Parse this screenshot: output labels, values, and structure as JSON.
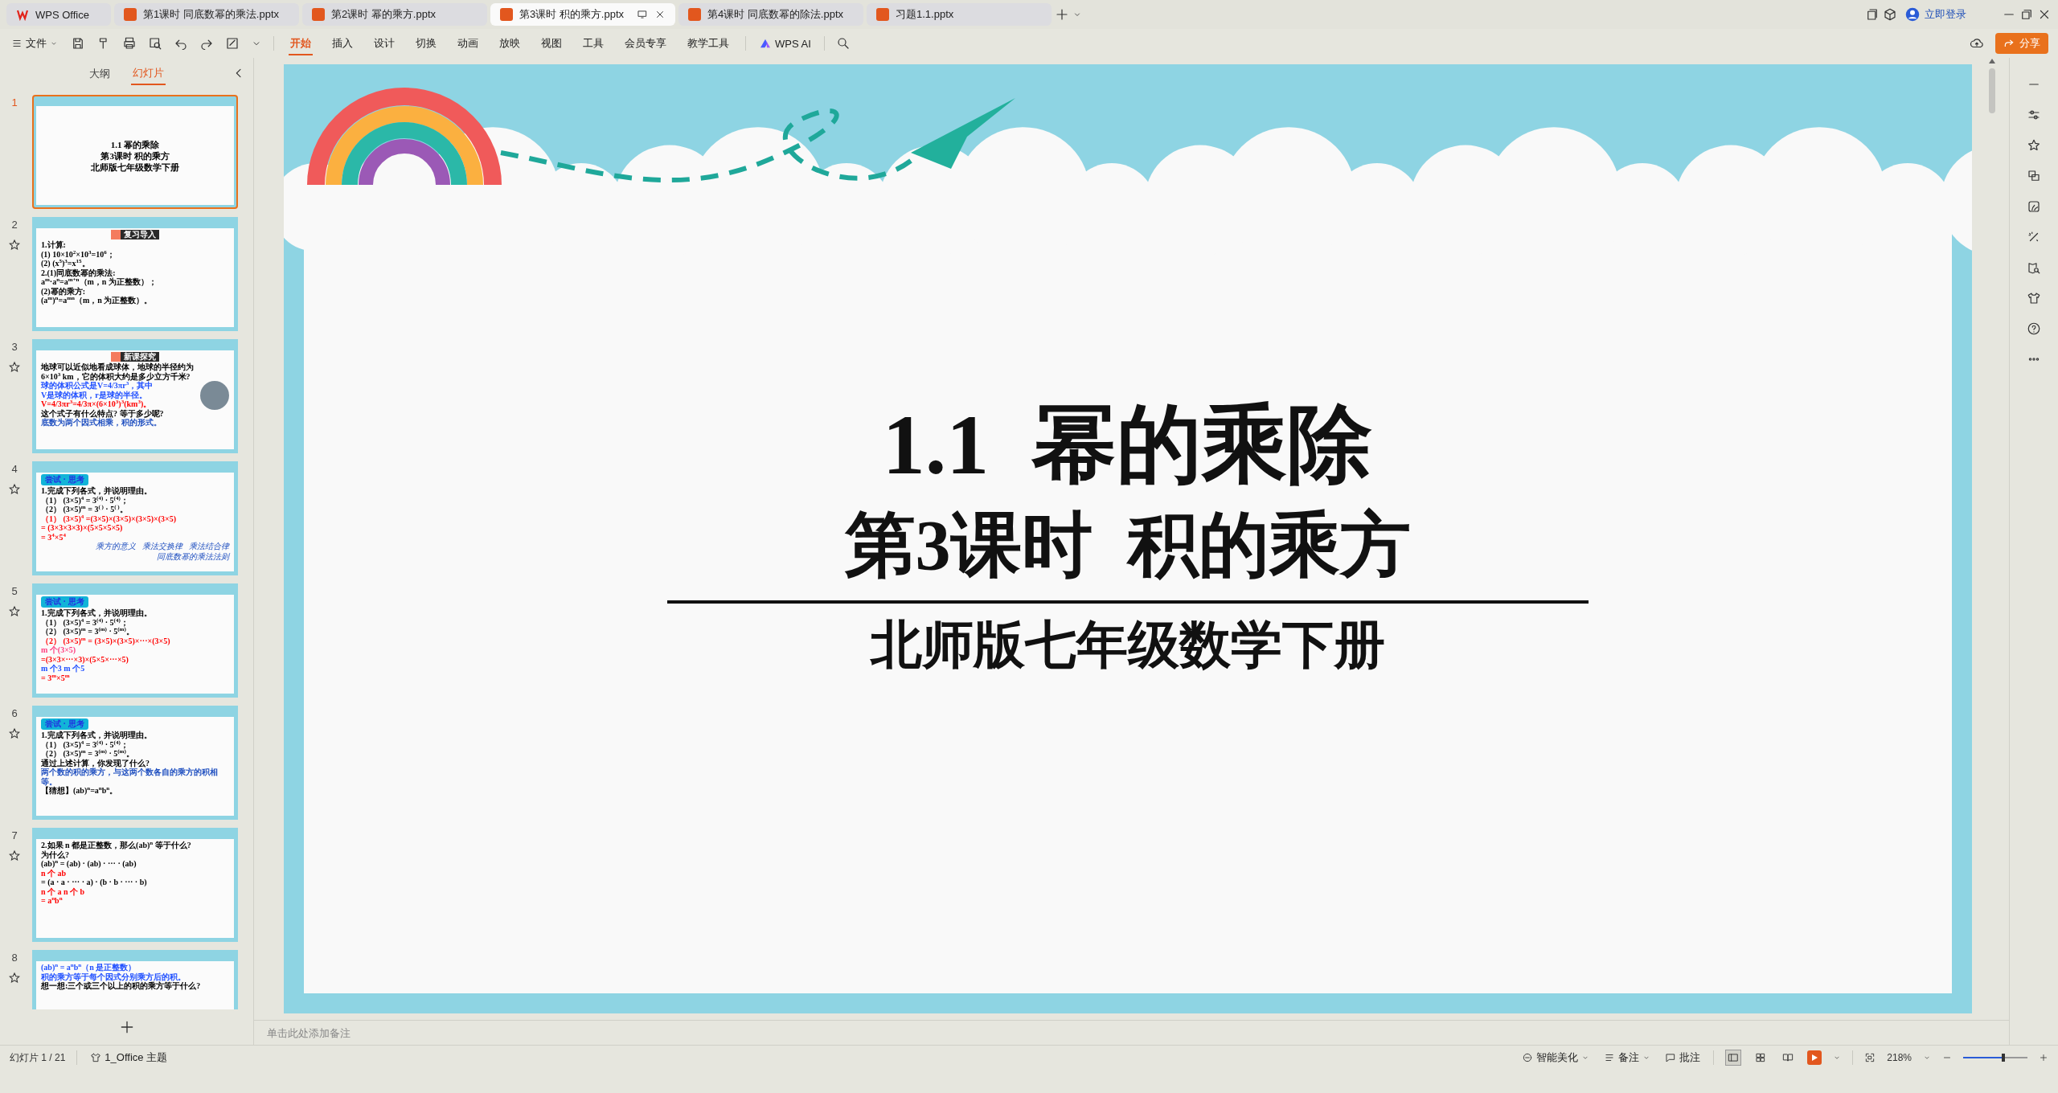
{
  "tabs": [
    {
      "label": "WPS Office",
      "kind": "home",
      "selected": false
    },
    {
      "label": "第1课时 同底数幂的乘法.pptx",
      "kind": "file",
      "selected": false
    },
    {
      "label": "第2课时 幂的乘方.pptx",
      "kind": "file",
      "selected": false
    },
    {
      "label": "第3课时 积的乘方.pptx",
      "kind": "file",
      "selected": true
    },
    {
      "label": "第4课时 同底数幂的除法.pptx",
      "kind": "file",
      "selected": false
    },
    {
      "label": "习题1.1.pptx",
      "kind": "file",
      "selected": false
    }
  ],
  "account": {
    "label": "立即登录"
  },
  "toolbar": {
    "file_menu": "文件",
    "ribbon_tabs": [
      {
        "label": "开始",
        "selected": true
      },
      {
        "label": "插入",
        "selected": false
      },
      {
        "label": "设计",
        "selected": false
      },
      {
        "label": "切换",
        "selected": false
      },
      {
        "label": "动画",
        "selected": false
      },
      {
        "label": "放映",
        "selected": false
      },
      {
        "label": "视图",
        "selected": false
      },
      {
        "label": "工具",
        "selected": false
      },
      {
        "label": "会员专享",
        "selected": false
      },
      {
        "label": "教学工具",
        "selected": false
      }
    ],
    "ai_label": "WPS AI",
    "share_label": "分享"
  },
  "side_panel": {
    "tabs": [
      {
        "label": "大纲",
        "selected": false
      },
      {
        "label": "幻灯片",
        "selected": true
      }
    ],
    "slides": [
      {
        "number": "1",
        "kind": "title",
        "selected": true,
        "animated": false,
        "lines": [
          {
            "text": "1.1  幂的乘除",
            "color": "#000000"
          },
          {
            "text": "第3课时  积的乘方",
            "color": "#000000"
          },
          {
            "text": "北师版七年级数学下册",
            "color": "#000000"
          }
        ]
      },
      {
        "number": "2",
        "kind": "content",
        "selected": false,
        "animated": true,
        "badge": {
          "text": "复习导入",
          "kind": "section"
        },
        "lines": [
          {
            "text": "1.计算:",
            "color": "#000000"
          },
          {
            "text": "(1) 10×10$^{2}$×10$^{3}$=10$^{6}$；",
            "color": "#000000"
          },
          {
            "text": "(2) (x$^{5}$)$^{3}$=x$^{15}$。",
            "color": "#000000"
          },
          {
            "text": "2.(1)同底数幂的乘法:",
            "color": "#000000"
          },
          {
            "text": "a$^{m}$·a$^{n}$=a$^{m+n}$（m，n 为正整数）；",
            "color": "#000000"
          },
          {
            "text": "(2)幂的乘方:",
            "color": "#000000"
          },
          {
            "text": "(a$^{m}$)$^{n}$=a$^{mn}$（m，n 为正整数）。",
            "color": "#000000"
          }
        ]
      },
      {
        "number": "3",
        "kind": "content",
        "selected": false,
        "animated": true,
        "badge": {
          "text": "新课探究",
          "kind": "section"
        },
        "photo": true,
        "lines": [
          {
            "text": "地球可以近似地看成球体，地球的半径约为",
            "color": "#000000"
          },
          {
            "text": "6×10$^{3}$ km，它的体积大约是多少立方千米?",
            "color": "#000000"
          },
          {
            "text": "球的体积公式是V=4/3πr$^{3}$，其中",
            "color": "#1f4fff"
          },
          {
            "text": "V是球的体积，r是球的半径。",
            "color": "#1f4fff"
          },
          {
            "text": "V=4/3πr$^{3}$=4/3π×(6×10$^{3}$)$^{3}$(km$^{3}$)。",
            "color": "#ff0000"
          },
          {
            "text": "这个式子有什么特点?  等于多少呢?",
            "color": "#000000"
          },
          {
            "text": "底数为两个因式相乘，积的形式。",
            "color": "#2050c0"
          }
        ]
      },
      {
        "number": "4",
        "kind": "content",
        "selected": false,
        "animated": true,
        "badge": {
          "text": "尝试 · 思考",
          "kind": "activity"
        },
        "lines": [
          {
            "text": "1.完成下列各式，并说明理由。",
            "color": "#000000"
          },
          {
            "text": "（1） (3×5)$^{4}$ = 3$^{(4)}$ · 5$^{(4)}$；",
            "color": "#000000"
          },
          {
            "text": "（2） (3×5)$^{m}$ = 3$^{( )}$ · 5$^{( )}$。",
            "color": "#000000"
          },
          {
            "text": "（1） (3×5)$^{4}$ =(3×5)×(3×5)×(3×5)×(3×5)",
            "color": "#ff0000"
          },
          {
            "text": "= (3×3×3×3)×(5×5×5×5)",
            "color": "#ff0000"
          },
          {
            "text": "= 3$^{4}$×5$^{4}$",
            "color": "#ff0000"
          }
        ],
        "notes": [
          "乘方的意义",
          "乘法交换律",
          "乘法结合律",
          "同底数幂的乘法法则"
        ]
      },
      {
        "number": "5",
        "kind": "content",
        "selected": false,
        "animated": true,
        "badge": {
          "text": "尝试 · 思考",
          "kind": "activity"
        },
        "lines": [
          {
            "text": "1.完成下列各式，并说明理由。",
            "color": "#000000"
          },
          {
            "text": "（1） (3×5)$^{4}$ = 3$^{(4)}$ · 5$^{(4)}$；",
            "color": "#000000"
          },
          {
            "text": "（2） (3×5)$^{m}$ = 3$^{(m)}$ · 5$^{(m)}$。",
            "color": "#000000"
          },
          {
            "text": "（2） (3×5)$^{m}$ = (3×5)×(3×5)×···×(3×5)",
            "color": "#ff0000"
          },
          {
            "text": "m 个(3×5)",
            "color": "#ff4080"
          },
          {
            "text": "=(3×3×···×3)×(5×5×···×5)",
            "color": "#ff0000"
          },
          {
            "text": "m 个3      m 个5",
            "color": "#1f4fff"
          },
          {
            "text": "= 3$^{m}$×5$^{m}$",
            "color": "#ff0000"
          }
        ]
      },
      {
        "number": "6",
        "kind": "content",
        "selected": false,
        "animated": true,
        "badge": {
          "text": "尝试 · 思考",
          "kind": "activity"
        },
        "lines": [
          {
            "text": "1.完成下列各式，并说明理由。",
            "color": "#000000"
          },
          {
            "text": "（1） (3×5)$^{4}$ = 3$^{(4)}$ · 5$^{(4)}$；",
            "color": "#000000"
          },
          {
            "text": "（2） (3×5)$^{m}$ = 3$^{(m)}$ · 5$^{(m)}$。",
            "color": "#000000"
          },
          {
            "text": "通过上述计算，你发现了什么?",
            "color": "#000000"
          },
          {
            "text": "两个数的积的乘方，与这两个数各自的乘方的积相等。",
            "color": "#2050c0"
          },
          {
            "text": "【猜想】(ab)$^{n}$=a$^{n}$b$^{n}$。",
            "color": "#000000"
          }
        ]
      },
      {
        "number": "7",
        "kind": "content",
        "selected": false,
        "animated": true,
        "lines": [
          {
            "text": "2.如果 n 都是正整数，那么(ab)$^{n}$ 等于什么?",
            "color": "#000000"
          },
          {
            "text": "为什么?",
            "color": "#000000"
          },
          {
            "text": "(ab)$^{n}$ = (ab) · (ab) · ··· · (ab)",
            "color": "#000000"
          },
          {
            "text": "n 个 ab",
            "color": "#ff0000"
          },
          {
            "text": "= (a · a · ··· · a) · (b · b · ··· · b)",
            "color": "#000000"
          },
          {
            "text": "n 个 a      n 个 b",
            "color": "#ff0000"
          },
          {
            "text": "= a$^{n}$b$^{n}$",
            "color": "#ff0000"
          }
        ]
      },
      {
        "number": "8",
        "kind": "content",
        "selected": false,
        "animated": true,
        "lines": [
          {
            "text": "(ab)$^{n}$ = a$^{n}$b$^{n}$（n 是正整数）",
            "color": "#1f4fff"
          },
          {
            "text": "积的乘方等于每个因式分别乘方后的积。",
            "color": "#1f4fff"
          },
          {
            "text": "想一想:三个或三个以上的积的乘方等于什么?",
            "color": "#000000"
          }
        ]
      }
    ]
  },
  "slide": {
    "title": "1.1  幂的乘除",
    "subtitle": "第3课时  积的乘方",
    "caption": "北师版七年级数学下册"
  },
  "notes": {
    "placeholder": "单击此处添加备注"
  },
  "status_bar": {
    "slide_counter": "幻灯片 1 / 21",
    "theme": "1_Office 主题",
    "beautify": "智能美化",
    "notes": "备注",
    "comments": "批注",
    "views": [
      {
        "kind": "normal",
        "selected": true
      },
      {
        "kind": "sorter",
        "selected": false
      },
      {
        "kind": "reading",
        "selected": false
      }
    ],
    "zoom": "218%",
    "zoom_slider": {
      "level": 0.62
    }
  }
}
